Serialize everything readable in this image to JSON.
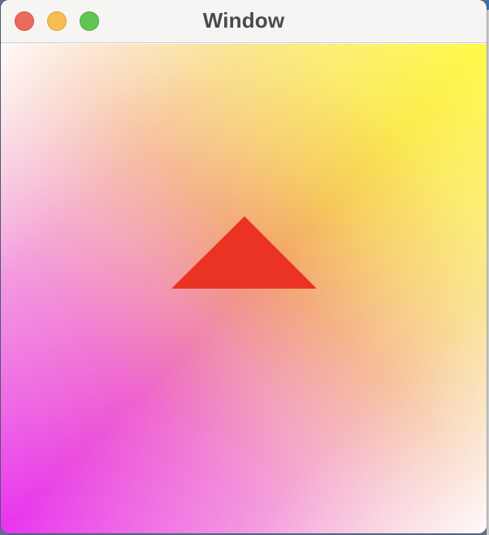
{
  "window": {
    "title": "Window"
  },
  "titlebar": {
    "buttons": [
      {
        "name": "close",
        "icon": "traffic-light-close-icon",
        "color": "#ed6a5e"
      },
      {
        "name": "minimize",
        "icon": "traffic-light-minimize-icon",
        "color": "#f5bf4f"
      },
      {
        "name": "zoom",
        "icon": "traffic-light-zoom-icon",
        "color": "#61c554"
      }
    ]
  },
  "canvas": {
    "background_colors": [
      "#e733f2",
      "#f2a06d",
      "#fffb49",
      "#ffffff"
    ],
    "shape": {
      "kind": "triangle",
      "fill": "#ea3323"
    }
  }
}
